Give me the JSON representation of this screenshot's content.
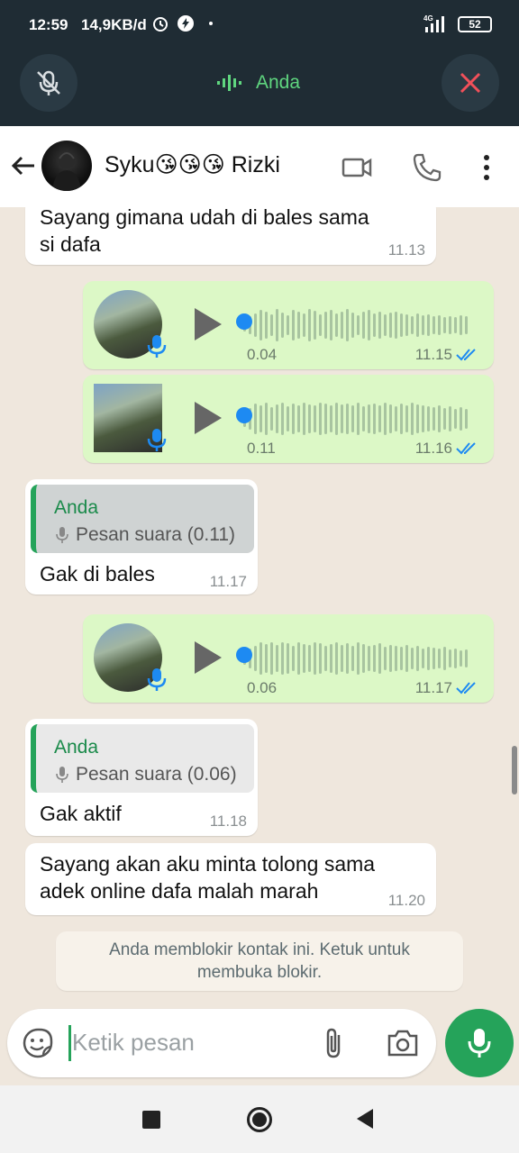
{
  "status_bar": {
    "time": "12:59",
    "speed": "14,9KB/d",
    "network": "4G",
    "battery": "52"
  },
  "call_bar": {
    "title": "Anda",
    "mute_icon": "mic-off-icon",
    "end_icon": "close-icon",
    "accent": "#5fd67f"
  },
  "header": {
    "contact_name": "Syku😘😘😘 Rizki",
    "icons": [
      "back-arrow-icon",
      "video-call-icon",
      "phone-icon",
      "more-vert-icon"
    ]
  },
  "messages": [
    {
      "type": "text",
      "direction": "in",
      "text_line1": "Sayang gimana udah di bales sama",
      "text_line2": "si dafa",
      "time": "11.13"
    },
    {
      "type": "voice",
      "direction": "out",
      "duration": "0.04",
      "time": "11.15"
    },
    {
      "type": "voice",
      "direction": "out",
      "duration": "0.11",
      "time": "11.16"
    },
    {
      "type": "reply",
      "direction": "in",
      "quote_name": "Anda",
      "quote_text": "Pesan suara (0.11)",
      "text": "Gak di bales",
      "time": "11.17"
    },
    {
      "type": "voice",
      "direction": "out",
      "duration": "0.06",
      "time": "11.17"
    },
    {
      "type": "reply",
      "direction": "in",
      "quote_name": "Anda",
      "quote_text": "Pesan suara (0.06)",
      "text": "Gak aktif",
      "time": "11.18"
    },
    {
      "type": "text",
      "direction": "in",
      "text_line1": "Sayang akan aku minta tolong sama",
      "text_line2": "adek online dafa malah marah",
      "time": "11.20"
    }
  ],
  "system_notice": {
    "line1": "Anda memblokir kontak ini. Ketuk untuk",
    "line2": "membuka blokir."
  },
  "input": {
    "placeholder": "Ketik pesan",
    "icons": [
      "sticker-icon",
      "attach-icon",
      "camera-icon",
      "mic-icon"
    ]
  },
  "colors": {
    "outgoing_bubble": "#dcf8c6",
    "incoming_bubble": "#ffffff",
    "brand_green": "#25a35a",
    "read_ticks": "#1d8af2"
  }
}
